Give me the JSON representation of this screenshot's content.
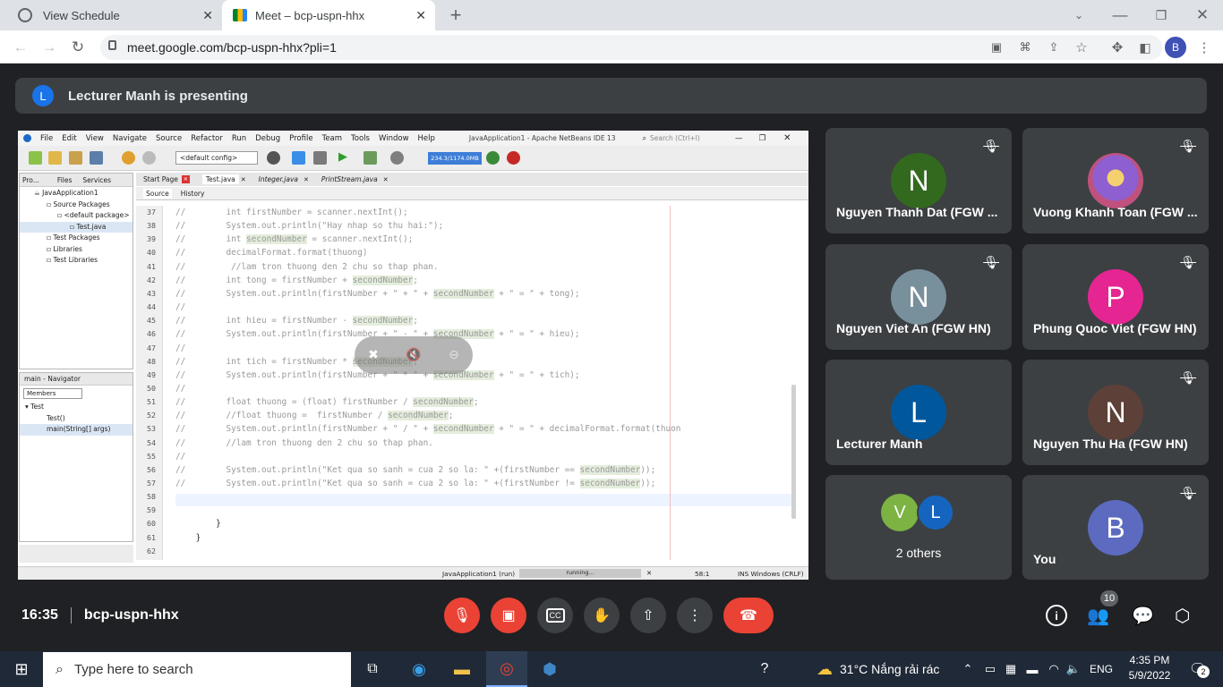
{
  "browser": {
    "tabs": [
      {
        "title": "View Schedule",
        "icon": "schedule-icon"
      },
      {
        "title": "Meet – bcp-uspn-hhx",
        "icon": "meet-icon"
      }
    ],
    "url": "meet.google.com/bcp-uspn-hhx?pli=1",
    "profile_initial": "B"
  },
  "meet": {
    "presenter_initial": "L",
    "presenting_banner": "Lecturer Manh is presenting",
    "time": "16:35",
    "meeting_code": "bcp-uspn-hhx",
    "participant_count": "10",
    "participants": [
      {
        "initial": "N",
        "name": "Nguyen Thanh Dat (FGW ...",
        "color": "#33691e",
        "muted": true
      },
      {
        "initial": "",
        "name": "Vuong Khanh Toan (FGW ...",
        "color": "#7e57c2",
        "muted": true,
        "has_photo": true
      },
      {
        "initial": "N",
        "name": "Nguyen Viet An (FGW HN)",
        "color": "#78909c",
        "muted": true
      },
      {
        "initial": "P",
        "name": "Phung Quoc Viet (FGW HN)",
        "color": "#e52592",
        "muted": true
      },
      {
        "initial": "L",
        "name": "Lecturer Manh",
        "color": "#01579b",
        "muted": false
      },
      {
        "initial": "N",
        "name": "Nguyen Thu Ha (FGW HN)",
        "color": "#5d4037",
        "muted": true
      },
      {
        "initial_a": "V",
        "initial_b": "L",
        "name": "2 others",
        "color_a": "#7cb342",
        "color_b": "#1565c0"
      },
      {
        "initial": "B",
        "name": "You",
        "color": "#5c6bc0",
        "muted": true
      }
    ]
  },
  "netbeans": {
    "menu": [
      "File",
      "Edit",
      "View",
      "Navigate",
      "Source",
      "Refactor",
      "Run",
      "Debug",
      "Profile",
      "Team",
      "Tools",
      "Window",
      "Help"
    ],
    "title": "JavaApplication1 - Apache NetBeans IDE 13",
    "search_placeholder": "Search (Ctrl+I)",
    "config": "<default config>",
    "memory": "234.3/1174.0MB",
    "project_tabs": [
      "Pro...",
      "Files",
      "Services"
    ],
    "tree": [
      "JavaApplication1",
      "Source Packages",
      "<default package>",
      "Test.java",
      "Test Packages",
      "Libraries",
      "Test Libraries"
    ],
    "navigator_title": "main - Navigator",
    "navigator_filter": "Members",
    "navigator_items": [
      "Test",
      "Test()",
      "main(String[] args)"
    ],
    "editor_tabs": [
      "Start Page",
      "Test.java",
      "Integer.java",
      "PrintStream.java"
    ],
    "source_tab": "Source",
    "history_tab": "History",
    "code_lines": [
      {
        "n": "37",
        "t": "//        int firstNumber = scanner.nextInt();"
      },
      {
        "n": "38",
        "t": "//        System.out.println(\"Hay nhap so thu hai:\");"
      },
      {
        "n": "39",
        "t": "//        int secondNumber = scanner.nextInt();"
      },
      {
        "n": "40",
        "t": "//        decimalFormat.format(thuong)"
      },
      {
        "n": "41",
        "t": "//         //lam tron thuong den 2 chu so thap phan."
      },
      {
        "n": "42",
        "t": "//        int tong = firstNumber + secondNumber;"
      },
      {
        "n": "43",
        "t": "//        System.out.println(firstNumber + \" + \" + secondNumber + \" = \" + tong);"
      },
      {
        "n": "44",
        "t": "//"
      },
      {
        "n": "45",
        "t": "//        int hieu = firstNumber - secondNumber;"
      },
      {
        "n": "46",
        "t": "//        System.out.println(firstNumber + \" - \" + secondNumber + \" = \" + hieu);"
      },
      {
        "n": "47",
        "t": "//"
      },
      {
        "n": "48",
        "t": "//        int tich = firstNumber * secondNumber;"
      },
      {
        "n": "49",
        "t": "//        System.out.println(firstNumber + \" * \" + secondNumber + \" = \" + tich);"
      },
      {
        "n": "50",
        "t": "//"
      },
      {
        "n": "51",
        "t": "//        float thuong = (float) firstNumber / secondNumber;"
      },
      {
        "n": "52",
        "t": "//        //float thuong =  firstNumber / secondNumber;"
      },
      {
        "n": "53",
        "t": "//        System.out.println(firstNumber + \" / \" + secondNumber + \" = \" + decimalFormat.format(thuon"
      },
      {
        "n": "54",
        "t": "//        //lam tron thuong den 2 chu so thap phan."
      },
      {
        "n": "55",
        "t": "//"
      },
      {
        "n": "56",
        "t": "//        System.out.println(\"Ket qua so sanh = cua 2 so la: \" +(firstNumber == secondNumber));"
      },
      {
        "n": "57",
        "t": "//        System.out.println(\"Ket qua so sanh = cua 2 so la: \" +(firstNumber != secondNumber));"
      },
      {
        "n": "58",
        "t": ""
      },
      {
        "n": "59",
        "t": ""
      },
      {
        "n": "60",
        "t": "        }"
      },
      {
        "n": "61",
        "t": "    }"
      },
      {
        "n": "62",
        "t": ""
      }
    ],
    "status_run": "JavaApplication1 (run)",
    "status_progress": "running...",
    "status_pos": "58:1",
    "status_mode": "INS Windows (CRLF)"
  },
  "taskbar": {
    "search_placeholder": "Type here to search",
    "weather": "31°C  Nắng rải rác",
    "lang": "ENG",
    "time": "4:35 PM",
    "date": "5/9/2022",
    "notif": "2"
  }
}
